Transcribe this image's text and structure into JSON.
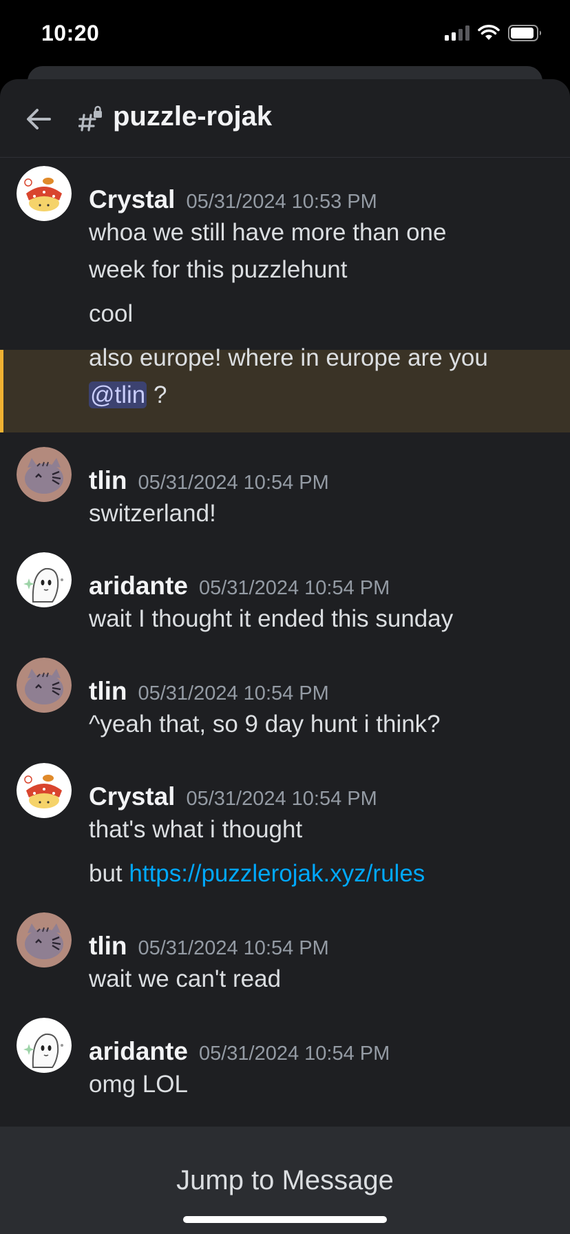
{
  "status": {
    "time": "10:20"
  },
  "channel": {
    "name": "puzzle-rojak",
    "icon": "channel-hash-locked-icon",
    "back_icon": "back-arrow-icon"
  },
  "messages": [
    {
      "author": "Crystal",
      "timestamp": "05/31/2024 10:53 PM",
      "avatar": "crystal-avatar",
      "lines": [
        "whoa we still have more than one",
        "week for this puzzlehunt"
      ]
    },
    {
      "lines": [
        "cool"
      ]
    },
    {
      "lines": [
        "also europe! where in europe are you"
      ],
      "mention": "@tlin",
      "mention_suffix": " ?",
      "highlighted": true
    },
    {
      "author": "tlin",
      "timestamp": "05/31/2024 10:54 PM",
      "avatar": "tlin-avatar",
      "lines": [
        "switzerland!"
      ]
    },
    {
      "author": "aridante",
      "timestamp": "05/31/2024 10:54 PM",
      "avatar": "aridante-avatar",
      "lines": [
        "wait I thought it ended this sunday"
      ]
    },
    {
      "author": "tlin",
      "timestamp": "05/31/2024 10:54 PM",
      "avatar": "tlin-avatar",
      "lines": [
        "^yeah that, so 9 day hunt i think?"
      ]
    },
    {
      "author": "Crystal",
      "timestamp": "05/31/2024 10:54 PM",
      "avatar": "crystal-avatar",
      "lines": [
        "that's what i thought"
      ]
    },
    {
      "prefix": "but ",
      "link": "https://puzzlerojak.xyz/rules"
    },
    {
      "author": "tlin",
      "timestamp": "05/31/2024 10:54 PM",
      "avatar": "tlin-avatar",
      "lines": [
        "wait we can't read"
      ]
    },
    {
      "author": "aridante",
      "timestamp": "05/31/2024 10:54 PM",
      "avatar": "aridante-avatar",
      "lines": [
        "omg LOL"
      ]
    }
  ],
  "footer": {
    "jump_label": "Jump to Message"
  },
  "colors": {
    "background": "#1e1f22",
    "highlight": "#3a3326",
    "highlight_bar": "#f0b232",
    "link": "#00a8fc",
    "mention_bg": "#3c4270"
  }
}
